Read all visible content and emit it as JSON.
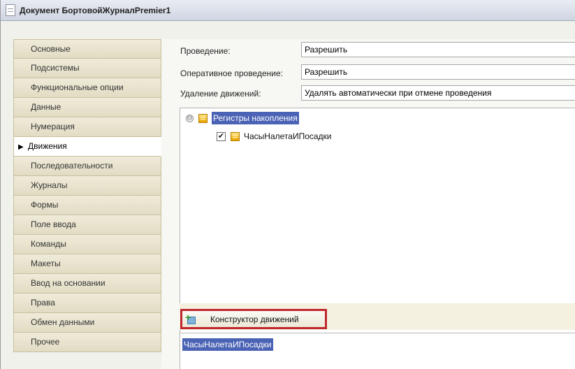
{
  "window": {
    "title": "Документ БортовойЖурналPremier1"
  },
  "tabs": [
    {
      "label": "Основные",
      "active": false
    },
    {
      "label": "Подсистемы",
      "active": false
    },
    {
      "label": "Функциональные опции",
      "active": false
    },
    {
      "label": "Данные",
      "active": false
    },
    {
      "label": "Нумерация",
      "active": false
    },
    {
      "label": "Движения",
      "active": true
    },
    {
      "label": "Последовательности",
      "active": false
    },
    {
      "label": "Журналы",
      "active": false
    },
    {
      "label": "Формы",
      "active": false
    },
    {
      "label": "Поле ввода",
      "active": false
    },
    {
      "label": "Команды",
      "active": false
    },
    {
      "label": "Макеты",
      "active": false
    },
    {
      "label": "Ввод на основании",
      "active": false
    },
    {
      "label": "Права",
      "active": false
    },
    {
      "label": "Обмен данными",
      "active": false
    },
    {
      "label": "Прочее",
      "active": false
    }
  ],
  "properties": {
    "posting_label": "Проведение:",
    "posting_value": "Разрешить",
    "realtime_label": "Оперативное проведение:",
    "realtime_value": "Разрешить",
    "delete_label": "Удаление движений:",
    "delete_value": "Удалять автоматически при отмене проведения"
  },
  "tree": {
    "root_label": "Регистры накопления",
    "root_toggle": "⊖",
    "child_label": "ЧасыНалетаИПосадки",
    "child_checked": true
  },
  "commands": {
    "constructor_label": "Конструктор движений"
  },
  "result": {
    "selected_text": "ЧасыНалетаИПосадки"
  },
  "colors": {
    "selection": "#4b63b5",
    "highlight_border": "#c0272d",
    "tab_bg": "#e2dcc4"
  }
}
